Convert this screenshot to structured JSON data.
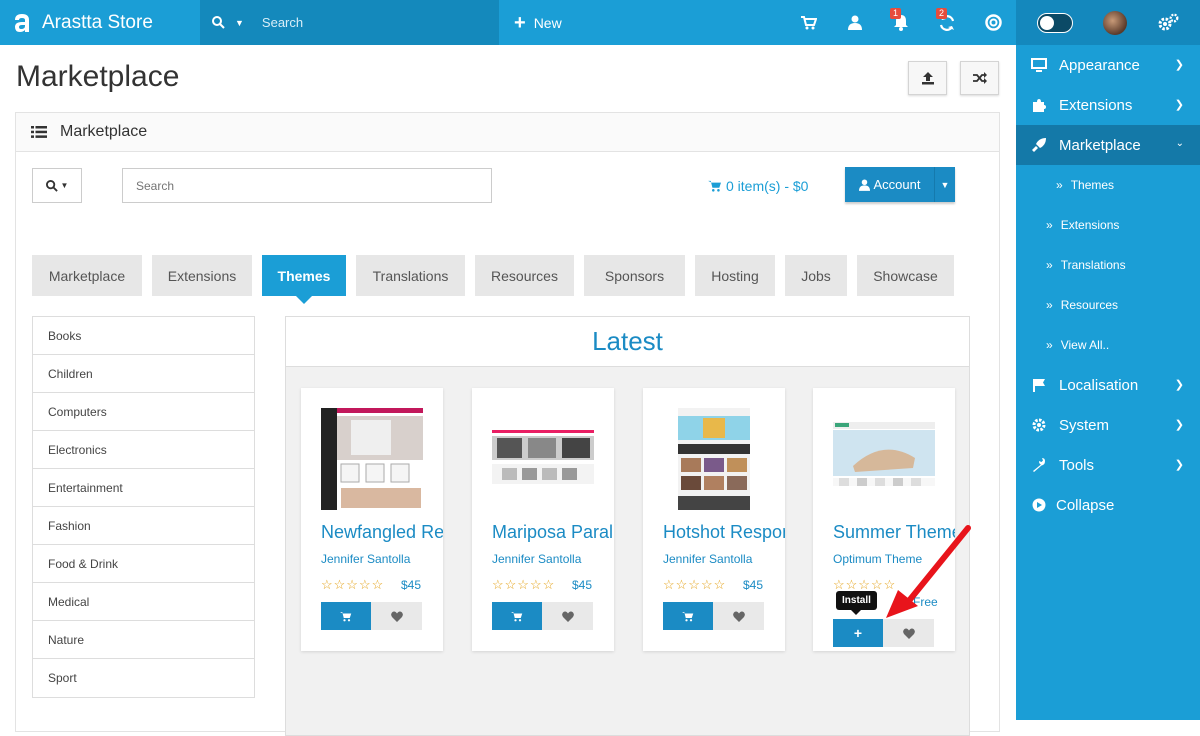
{
  "topbar": {
    "brand": "Arastta Store",
    "search_placeholder": "Search",
    "new_label": "New",
    "notif_badge": "1",
    "refresh_badge": "2"
  },
  "sidebar": {
    "items": [
      {
        "label": "Appearance",
        "icon": "monitor-icon"
      },
      {
        "label": "Extensions",
        "icon": "puzzle-icon"
      },
      {
        "label": "Marketplace",
        "icon": "rocket-icon"
      },
      {
        "label": "Localisation",
        "icon": "flag-icon"
      },
      {
        "label": "System",
        "icon": "gear-icon"
      },
      {
        "label": "Tools",
        "icon": "wrench-icon"
      },
      {
        "label": "Collapse",
        "icon": "play-circle-icon"
      }
    ],
    "subitems": [
      "Themes",
      "Extensions",
      "Translations",
      "Resources",
      "View All.."
    ]
  },
  "page": {
    "title": "Marketplace"
  },
  "panel": {
    "heading": "Marketplace",
    "search_placeholder": "Search",
    "cart": "0 item(s) - $0",
    "account": "Account"
  },
  "tabs": [
    "Marketplace",
    "Extensions",
    "Themes",
    "Translations",
    "Resources",
    "Sponsors",
    "Hosting",
    "Jobs",
    "Showcase"
  ],
  "categories": [
    "Books",
    "Children",
    "Computers",
    "Electronics",
    "Entertainment",
    "Fashion",
    "Food & Drink",
    "Medical",
    "Nature",
    "Sport"
  ],
  "latest": {
    "heading": "Latest",
    "cards": [
      {
        "title": "Newfangled Responsive",
        "author": "Jennifer Santolla",
        "price": "$45"
      },
      {
        "title": "Mariposa Parallax",
        "author": "Jennifer Santolla",
        "price": "$45"
      },
      {
        "title": "Hotshot Responsive",
        "author": "Jennifer Santolla",
        "price": "$45"
      },
      {
        "title": "Summer Theme",
        "author": "Optimum Theme",
        "price": "Free"
      }
    ],
    "tooltip": "Install"
  },
  "colors": {
    "primary": "#1b9ed6",
    "accent_dark": "#1b8bc4",
    "star": "#e4a31b",
    "arrow": "#e8141b"
  }
}
